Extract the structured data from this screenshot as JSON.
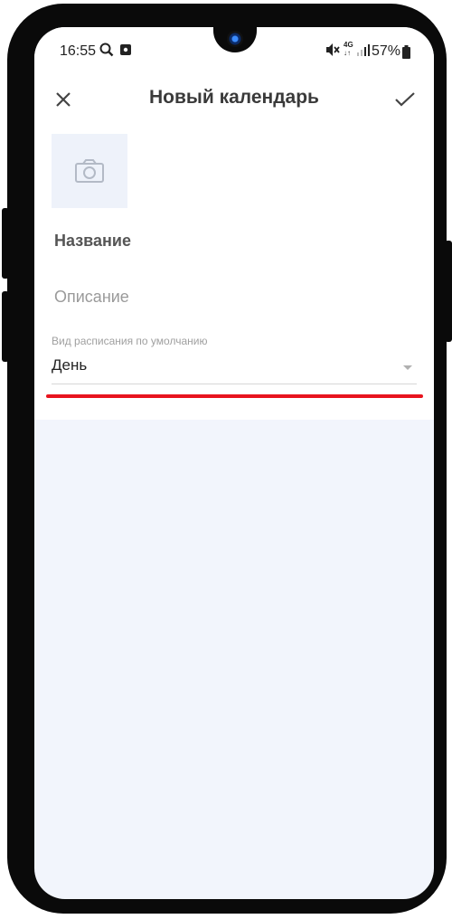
{
  "status_bar": {
    "time": "16:55",
    "network_top": "4G",
    "battery_percent": "57%"
  },
  "app_bar": {
    "title": "Новый календарь",
    "close_icon": "close-icon",
    "confirm_icon": "check-icon"
  },
  "form": {
    "photo_icon": "camera-icon",
    "name_placeholder": "Название",
    "description_placeholder": "Описание",
    "schedule_view_label": "Вид расписания по умолчанию",
    "schedule_view_value": "День"
  },
  "colors": {
    "background": "#f2f5fc",
    "accent_red": "#e8141e",
    "title_text": "#3a3a3a"
  }
}
